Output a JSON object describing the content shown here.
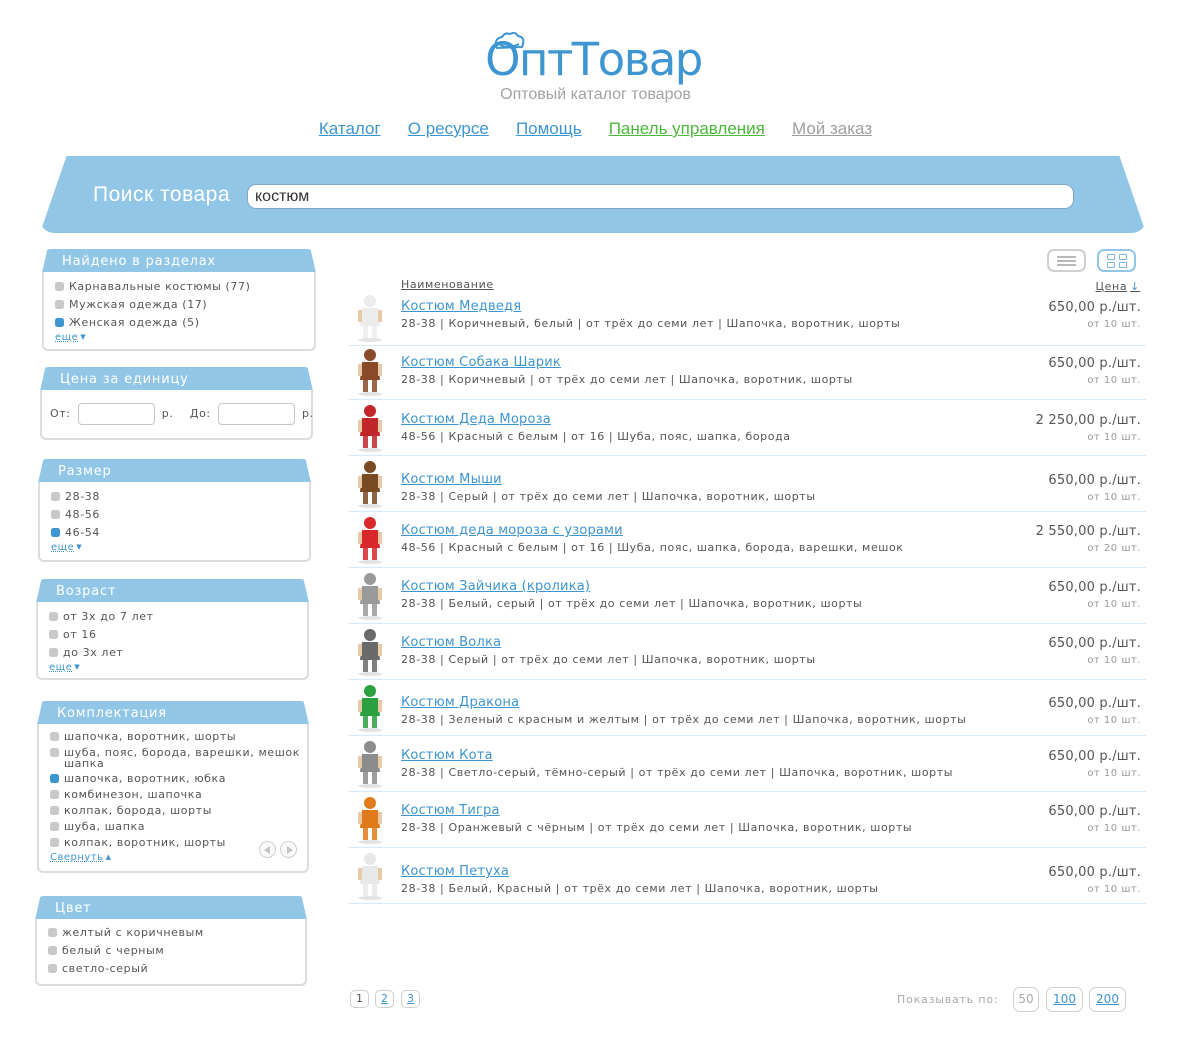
{
  "header": {
    "logo_text": "ОптТовар",
    "tagline": "Оптовый каталог товаров",
    "nav": [
      {
        "label": "Каталог"
      },
      {
        "label": "О ресурсе"
      },
      {
        "label": "Помощь"
      },
      {
        "label": "Панель управления"
      },
      {
        "label": "Мой заказ"
      }
    ]
  },
  "search": {
    "label": "Поиск товара",
    "value": "костюм"
  },
  "filters": {
    "sections": {
      "title": "Найдено в разделах",
      "items": [
        {
          "label": "Карнавальные костюмы (77)",
          "selected": false
        },
        {
          "label": "Мужская одежда (17)",
          "selected": false
        },
        {
          "label": "Женская одежда (5)",
          "selected": true
        }
      ],
      "more": "еще"
    },
    "price": {
      "title": "Цена за единицу",
      "from": "От:",
      "to": "До:",
      "unit": "р."
    },
    "size": {
      "title": "Размер",
      "items": [
        {
          "label": "28-38",
          "selected": false
        },
        {
          "label": "48-56",
          "selected": false
        },
        {
          "label": "46-54",
          "selected": true
        }
      ],
      "more": "еще"
    },
    "age": {
      "title": "Возраст",
      "items": [
        {
          "label": "от 3х до 7 лет",
          "selected": false
        },
        {
          "label": "от 16",
          "selected": false
        },
        {
          "label": "до 3х лет",
          "selected": false
        }
      ],
      "more": "еще"
    },
    "kit": {
      "title": "Комплектация",
      "items": [
        {
          "label": "шапочка, воротник, шорты",
          "selected": false
        },
        {
          "label": "шуба, пояс, борода, варешки, мешок шапка",
          "selected": false
        },
        {
          "label": "шапочка, воротник, юбка",
          "selected": true
        },
        {
          "label": "комбинезон, шапочка",
          "selected": false
        },
        {
          "label": "колпак, борода, шорты",
          "selected": false
        },
        {
          "label": "шуба, шапка",
          "selected": false
        },
        {
          "label": "колпак, воротник, шорты",
          "selected": false
        }
      ],
      "collapse": "Свернуть"
    },
    "color": {
      "title": "Цвет",
      "items": [
        {
          "label": "желтый с коричневым",
          "selected": false
        },
        {
          "label": "белый с черным",
          "selected": false
        },
        {
          "label": "светло-серый",
          "selected": false
        }
      ]
    }
  },
  "list": {
    "col_name": "Наименование",
    "col_price": "Цена",
    "sort_icon": "arrow-down-icon",
    "products": [
      {
        "name": "Костюм Медведя",
        "desc": "28-38 | Коричневый, белый | от трёх до семи лет | Шапочка, воротник, шорты",
        "price": "650,00 р./шт.",
        "min": "от 10 шт.",
        "color": "#ececec"
      },
      {
        "name": "Костюм Собака Шарик",
        "desc": "28-38 | Коричневый | от трёх до семи лет | Шапочка, воротник, шорты",
        "price": "650,00 р./шт.",
        "min": "от 10 шт.",
        "color": "#8a4a2a"
      },
      {
        "name": "Костюм Деда Мороза",
        "desc": "48-56 | Красный с белым | от 16 | Шуба, пояс, шапка, борода",
        "price": "2 250,00 р./шт.",
        "min": "от 10 шт.",
        "color": "#c0262a"
      },
      {
        "name": "Костюм Мыши",
        "desc": "28-38 | Серый | от трёх до семи лет | Шапочка, воротник, шорты",
        "price": "650,00 р./шт.",
        "min": "от 10 шт.",
        "color": "#7a4a22"
      },
      {
        "name": "Костюм деда мороза с узорами",
        "desc": "48-56 | Красный с белым | от 16 | Шуба, пояс, шапка, борода, варешки, мешок",
        "price": "2 550,00 р./шт.",
        "min": "от 20 шт.",
        "color": "#d8282c"
      },
      {
        "name": "Костюм Зайчика (кролика)",
        "desc": "28-38 | Белый, серый | от трёх до семи лет | Шапочка, воротник, шорты",
        "price": "650,00 р./шт.",
        "min": "от 10 шт.",
        "color": "#9a9a9a"
      },
      {
        "name": "Костюм Волка",
        "desc": "28-38 | Серый | от трёх до семи лет | Шапочка, воротник, шорты",
        "price": "650,00 р./шт.",
        "min": "от 10 шт.",
        "color": "#6a6a6a"
      },
      {
        "name": "Костюм Дракона",
        "desc": "28-38 | Зеленый с красным и желтым | от трёх до семи лет | Шапочка, воротник, шорты",
        "price": "650,00 р./шт.",
        "min": "от 10 шт.",
        "color": "#2aa040"
      },
      {
        "name": "Костюм Кота",
        "desc": "28-38 | Светло-серый, тёмно-серый | от трёх до семи лет | Шапочка, воротник, шорты",
        "price": "650,00 р./шт.",
        "min": "от 10 шт.",
        "color": "#8c8c8c"
      },
      {
        "name": "Костюм Тигра",
        "desc": "28-38 | Оранжевый с чёрным | от трёх до семи лет | Шапочка, воротник, шорты",
        "price": "650,00 р./шт.",
        "min": "от 10 шт.",
        "color": "#e07a1a"
      },
      {
        "name": "Костюм Петуха",
        "desc": "28-38 | Белый, Красный | от трёх до семи лет | Шапочка, воротник, шорты",
        "price": "650,00 р./шт.",
        "min": "от 10 шт.",
        "color": "#e8e8e8"
      }
    ]
  },
  "pagination": {
    "pages": [
      "1",
      "2",
      "3"
    ],
    "current_page": "1",
    "show_label": "Показывать по:",
    "per_page": [
      "50",
      "100",
      "200"
    ],
    "current_per_page": "50"
  },
  "colors": {
    "accent": "#3d95d1",
    "band": "#92c6e7",
    "green_link": "#4bb93a",
    "muted_link": "#9e9e9e"
  }
}
